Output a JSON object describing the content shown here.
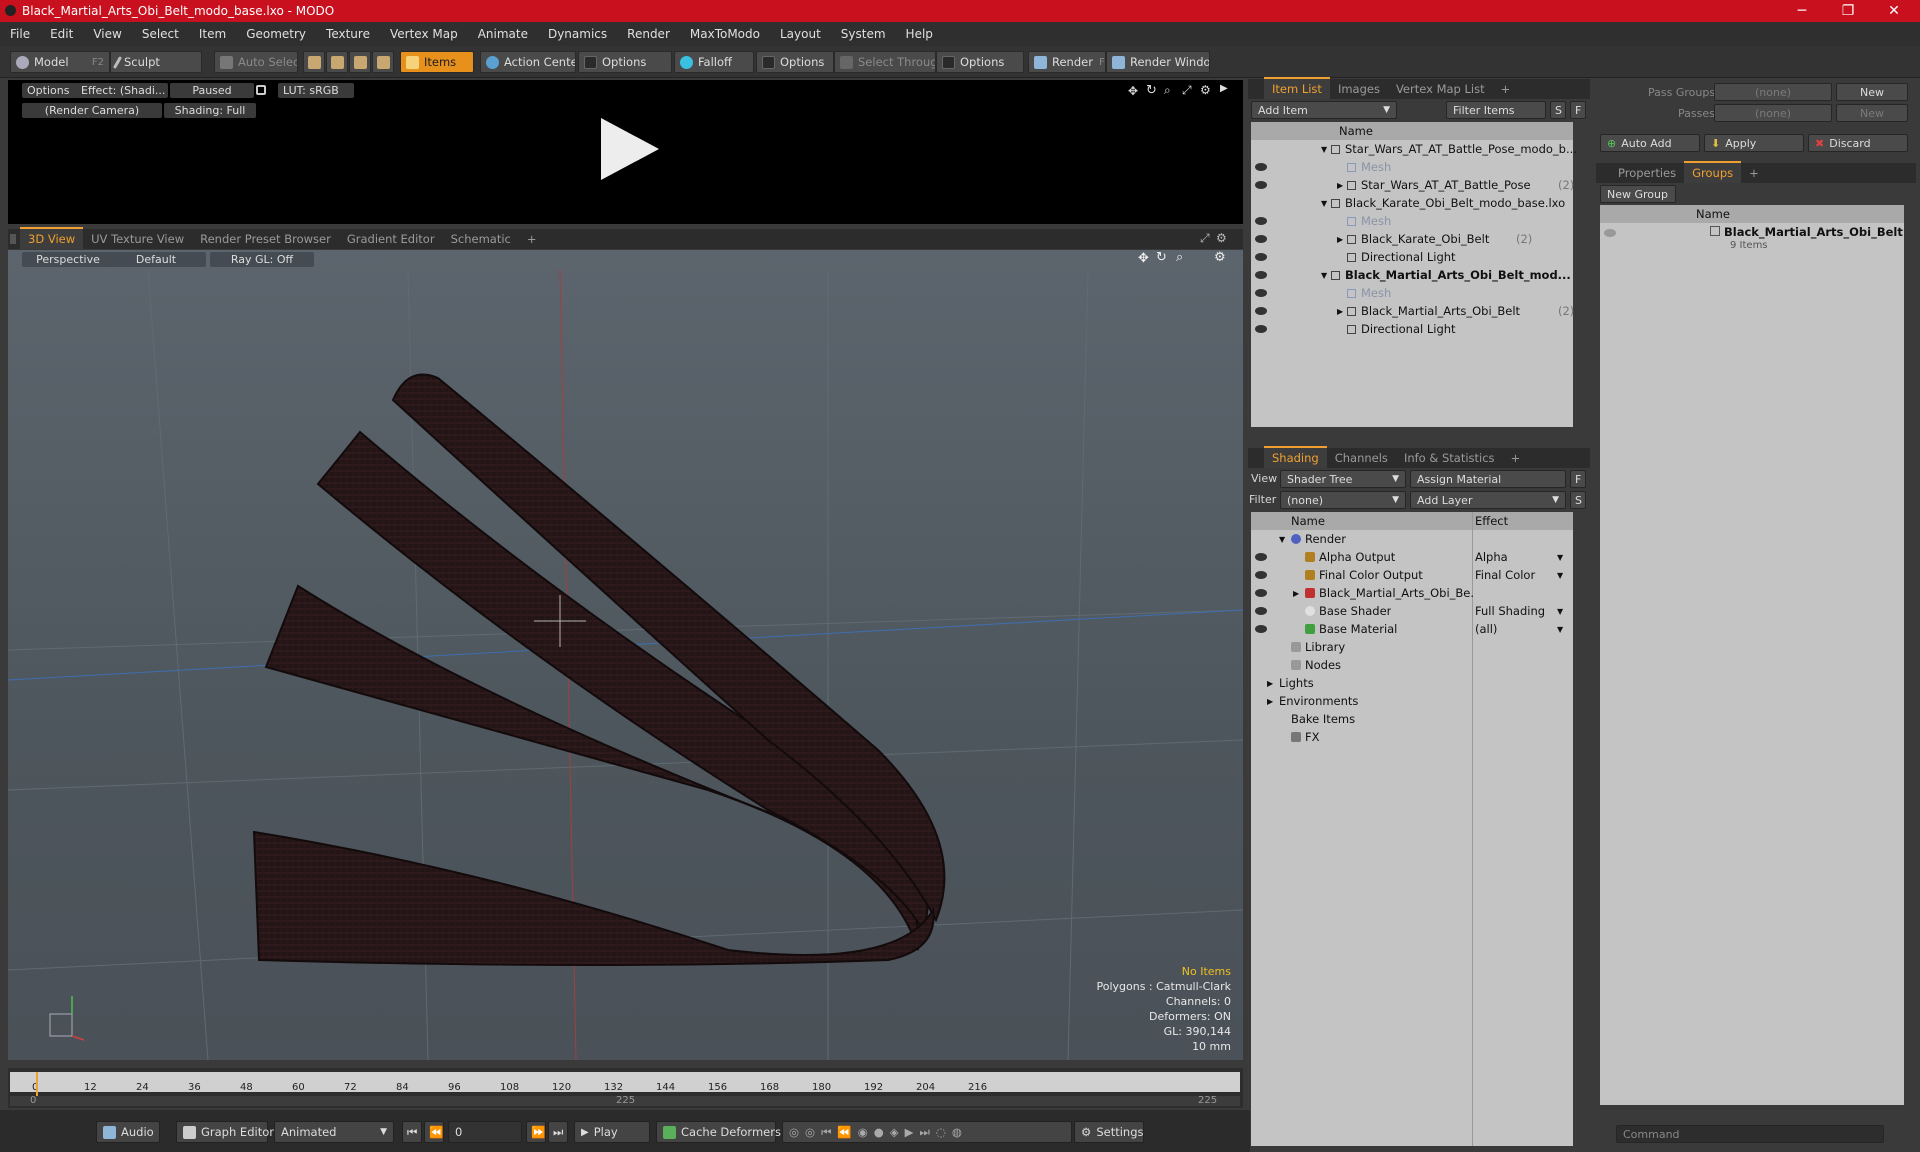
{
  "window": {
    "title": "Black_Martial_Arts_Obi_Belt_modo_base.lxo - MODO",
    "controls": [
      "─",
      "❐",
      "✕"
    ]
  },
  "menu": [
    "File",
    "Edit",
    "View",
    "Select",
    "Item",
    "Geometry",
    "Texture",
    "Vertex Map",
    "Animate",
    "Dynamics",
    "Render",
    "MaxToModo",
    "Layout",
    "System",
    "Help"
  ],
  "toolbar": {
    "model": "Model",
    "model_key": "F2",
    "sculpt": "Sculpt",
    "auto_select": "Auto Select",
    "items": "Items",
    "action_center": "Action Center",
    "options1": "Options",
    "falloff": "Falloff",
    "options2": "Options",
    "select_through": "Select Through",
    "options3": "Options",
    "render": "Render",
    "render_key": "F9",
    "render_window": "Render Window"
  },
  "render_panel": {
    "options": "Options",
    "effect": "Effect: (Shadi...",
    "paused": "Paused",
    "lut": "LUT: sRGB",
    "camera": "(Render Camera)",
    "shading": "Shading: Full"
  },
  "view_tabs": [
    "3D View",
    "UV Texture View",
    "Render Preset Browser",
    "Gradient Editor",
    "Schematic"
  ],
  "viewport": {
    "perspective": "Perspective",
    "default": "Default",
    "raygl": "Ray GL: Off",
    "info": {
      "items": "No Items",
      "polygons": "Polygons : Catmull-Clark",
      "channels": "Channels: 0",
      "deformers": "Deformers: ON",
      "gl": "GL: 390,144",
      "unit": "10 mm"
    },
    "item_color": "#f0c020"
  },
  "timeline": {
    "ticks": [
      "0",
      "12",
      "24",
      "36",
      "48",
      "60",
      "72",
      "84",
      "96",
      "108",
      "120",
      "132",
      "144",
      "156",
      "168",
      "180",
      "192",
      "204",
      "216"
    ],
    "sub": [
      "0",
      "225",
      "225"
    ]
  },
  "bottom": {
    "audio": "Audio",
    "graph_editor": "Graph Editor",
    "animated": "Animated",
    "frame": "0",
    "play": "Play",
    "cache": "Cache Deformers",
    "settings": "Settings"
  },
  "item_list": {
    "tabs": [
      "Item List",
      "Images",
      "Vertex Map List"
    ],
    "add_item": "Add Item",
    "filter": "Filter Items",
    "s": "S",
    "f": "F",
    "col_name": "Name",
    "rows": [
      {
        "label": "Star_Wars_AT_AT_Battle_Pose_modo_b...",
        "bold": false,
        "dim": false
      },
      {
        "label": "Mesh",
        "bold": false,
        "dim": true
      },
      {
        "label": "Star_Wars_AT_AT_Battle_Pose",
        "count": "(2)",
        "bold": false,
        "dim": false
      },
      {
        "label": "Black_Karate_Obi_Belt_modo_base.lxo",
        "bold": false,
        "dim": false
      },
      {
        "label": "Mesh",
        "bold": false,
        "dim": true
      },
      {
        "label": "Black_Karate_Obi_Belt",
        "count": "(2)",
        "bold": false,
        "dim": false
      },
      {
        "label": "Directional Light",
        "bold": false,
        "dim": false
      },
      {
        "label": "Black_Martial_Arts_Obi_Belt_mod...",
        "bold": true,
        "dim": false
      },
      {
        "label": "Mesh",
        "bold": false,
        "dim": true
      },
      {
        "label": "Black_Martial_Arts_Obi_Belt",
        "count": "(2)",
        "bold": false,
        "dim": false
      },
      {
        "label": "Directional Light",
        "bold": false,
        "dim": false
      }
    ]
  },
  "shading": {
    "tabs": [
      "Shading",
      "Channels",
      "Info & Statistics"
    ],
    "view_label": "View",
    "view_value": "Shader Tree",
    "assign": "Assign Material",
    "filter_label": "Filter",
    "filter_value": "(none)",
    "add_layer": "Add Layer",
    "f": "F",
    "s": "S",
    "col_name": "Name",
    "col_effect": "Effect",
    "rows": [
      {
        "label": "Render",
        "effect": ""
      },
      {
        "label": "Alpha Output",
        "effect": "Alpha"
      },
      {
        "label": "Final Color Output",
        "effect": "Final Color"
      },
      {
        "label": "Black_Martial_Arts_Obi_Be...",
        "effect": ""
      },
      {
        "label": "Base Shader",
        "effect": "Full Shading"
      },
      {
        "label": "Base Material",
        "effect": "(all)"
      },
      {
        "label": "Library",
        "effect": ""
      },
      {
        "label": "Nodes",
        "effect": ""
      },
      {
        "label": "Lights",
        "effect": ""
      },
      {
        "label": "Environments",
        "effect": ""
      },
      {
        "label": "Bake Items",
        "effect": ""
      },
      {
        "label": "FX",
        "effect": ""
      }
    ]
  },
  "groups_panel": {
    "pass_groups": "Pass Groups",
    "passes": "Passes",
    "none1": "(none)",
    "none2": "(none)",
    "new1": "New",
    "new2": "New",
    "auto_add": "Auto Add",
    "apply": "Apply",
    "discard": "Discard",
    "tabs": [
      "Properties",
      "Groups"
    ],
    "new_group": "New Group",
    "col_name": "Name",
    "group_name": "Black_Martial_Arts_Obi_Belt",
    "group_items": "9 Items",
    "command": "Command"
  }
}
